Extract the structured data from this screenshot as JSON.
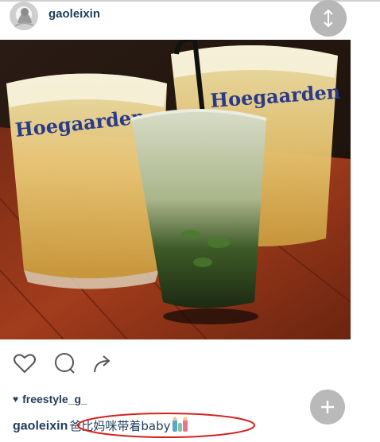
{
  "header": {
    "username": "gaoleixin",
    "avatar_icon": "avatar-icon",
    "scroll_icon": "vertical-arrows-icon"
  },
  "photo": {
    "description_icon": "photo",
    "glass_brand_left": "Hoegaarden",
    "glass_brand_right": "Hoegaarden"
  },
  "actions": {
    "like_icon": "heart-icon",
    "comment_icon": "comment-icon",
    "share_icon": "share-icon"
  },
  "likes": {
    "heart_icon": "heart-filled-icon",
    "user": "freestyle_g_"
  },
  "caption": {
    "user": "gaoleixin",
    "text": "爸比妈咪带着baby",
    "emoji_icon": "family-emoji-icon"
  },
  "add_button": {
    "icon": "plus-icon"
  },
  "colors": {
    "username_blue": "#1f3d5c",
    "button_gray": "#b7b7b7",
    "highlight_red": "#d62020"
  }
}
